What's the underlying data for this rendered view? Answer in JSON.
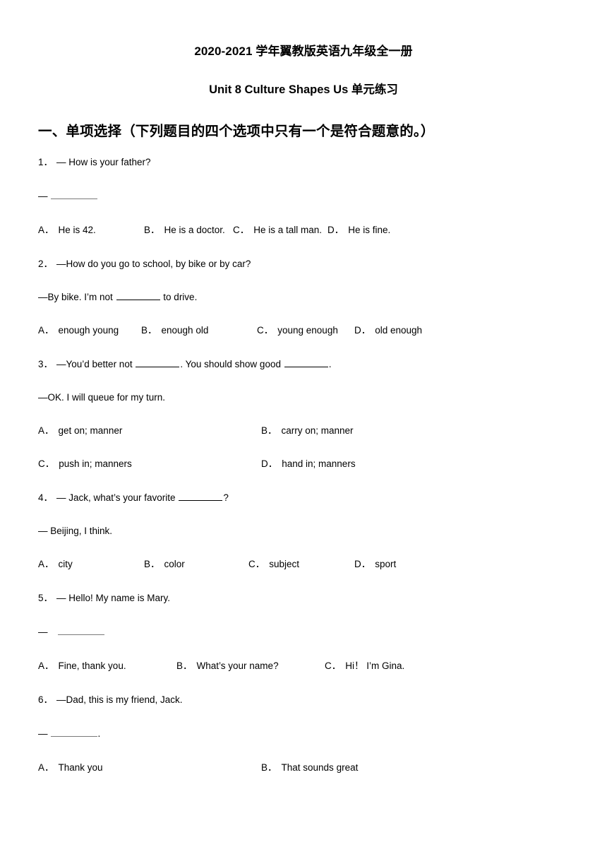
{
  "document": {
    "title": "2020-2021 学年翼教版英语九年级全一册",
    "subtitle": "Unit 8 Culture Shapes Us 单元练习",
    "section_heading": "一、单项选择（下列题目的四个选项中只有一个是符合题意的。）"
  },
  "questions": [
    {
      "number": "1．",
      "stem": "— How is your father?",
      "answer_line_prefix": "—",
      "options": [
        {
          "letter": "A．",
          "text": "He is 42."
        },
        {
          "letter": "B．",
          "text": "He is a doctor."
        },
        {
          "letter": "C．",
          "text": "He is a tall man."
        },
        {
          "letter": "D．",
          "text": "He is fine."
        }
      ]
    },
    {
      "number": "2．",
      "stem": "—How do you go to school, by bike or by car?",
      "reply_before": "—By bike. I’m not ",
      "reply_after": " to drive.",
      "options": [
        {
          "letter": "A．",
          "text": "enough young"
        },
        {
          "letter": "B．",
          "text": "enough old"
        },
        {
          "letter": "C．",
          "text": "young enough"
        },
        {
          "letter": "D．",
          "text": "old enough"
        }
      ]
    },
    {
      "number": "3．",
      "stem_part1": "—You’d better not ",
      "stem_part2": ". You should show good ",
      "stem_part3": ".",
      "reply": "—OK. I will queue for my turn.",
      "options": [
        {
          "letter": "A．",
          "text": "get on; manner"
        },
        {
          "letter": "B．",
          "text": "carry on; manner"
        },
        {
          "letter": "C．",
          "text": "push in; manners"
        },
        {
          "letter": "D．",
          "text": "hand in; manners"
        }
      ]
    },
    {
      "number": "4．",
      "stem_part1": "— Jack, what’s your favorite ",
      "stem_part2": "?",
      "reply": "— Beijing, I think.",
      "options": [
        {
          "letter": "A．",
          "text": "city"
        },
        {
          "letter": "B．",
          "text": "color"
        },
        {
          "letter": "C．",
          "text": "subject"
        },
        {
          "letter": "D．",
          "text": "sport"
        }
      ]
    },
    {
      "number": "5．",
      "stem": "— Hello! My name is Mary.",
      "answer_line_prefix": "—",
      "options": [
        {
          "letter": "A．",
          "text": "Fine, thank you."
        },
        {
          "letter": "B．",
          "text": "What’s your name?"
        },
        {
          "letter": "C．",
          "text": "Hi！ I’m Gina."
        }
      ]
    },
    {
      "number": "6．",
      "stem": "—Dad, this is my friend, Jack.",
      "answer_line_prefix": "—",
      "answer_line_suffix": ".",
      "options": [
        {
          "letter": "A．",
          "text": "Thank you"
        },
        {
          "letter": "B．",
          "text": "That sounds great"
        }
      ]
    }
  ]
}
